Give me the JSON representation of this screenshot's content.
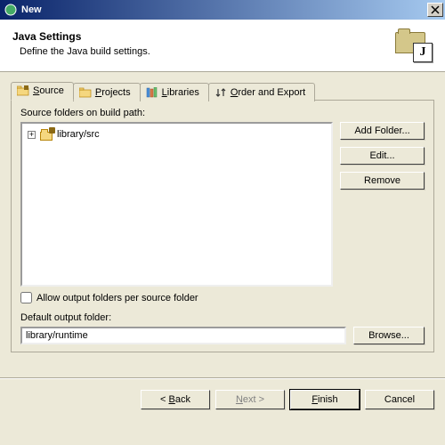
{
  "window": {
    "title": "New"
  },
  "banner": {
    "title": "Java Settings",
    "desc": "Define the Java build settings."
  },
  "tabs": {
    "source": "Source",
    "projects": "Projects",
    "libraries": "Libraries",
    "order": "Order and Export"
  },
  "sourcePanel": {
    "label": "Source folders on build path:",
    "treeItem": "library/src",
    "addFolder": "Add Folder...",
    "edit": "Edit...",
    "remove": "Remove",
    "allowOutput": "Allow output folders per source folder"
  },
  "output": {
    "label": "Default output folder:",
    "value": "library/runtime",
    "browse": "Browse..."
  },
  "footer": {
    "back": "< Back",
    "next": "Next >",
    "finish": "Finish",
    "cancel": "Cancel"
  }
}
